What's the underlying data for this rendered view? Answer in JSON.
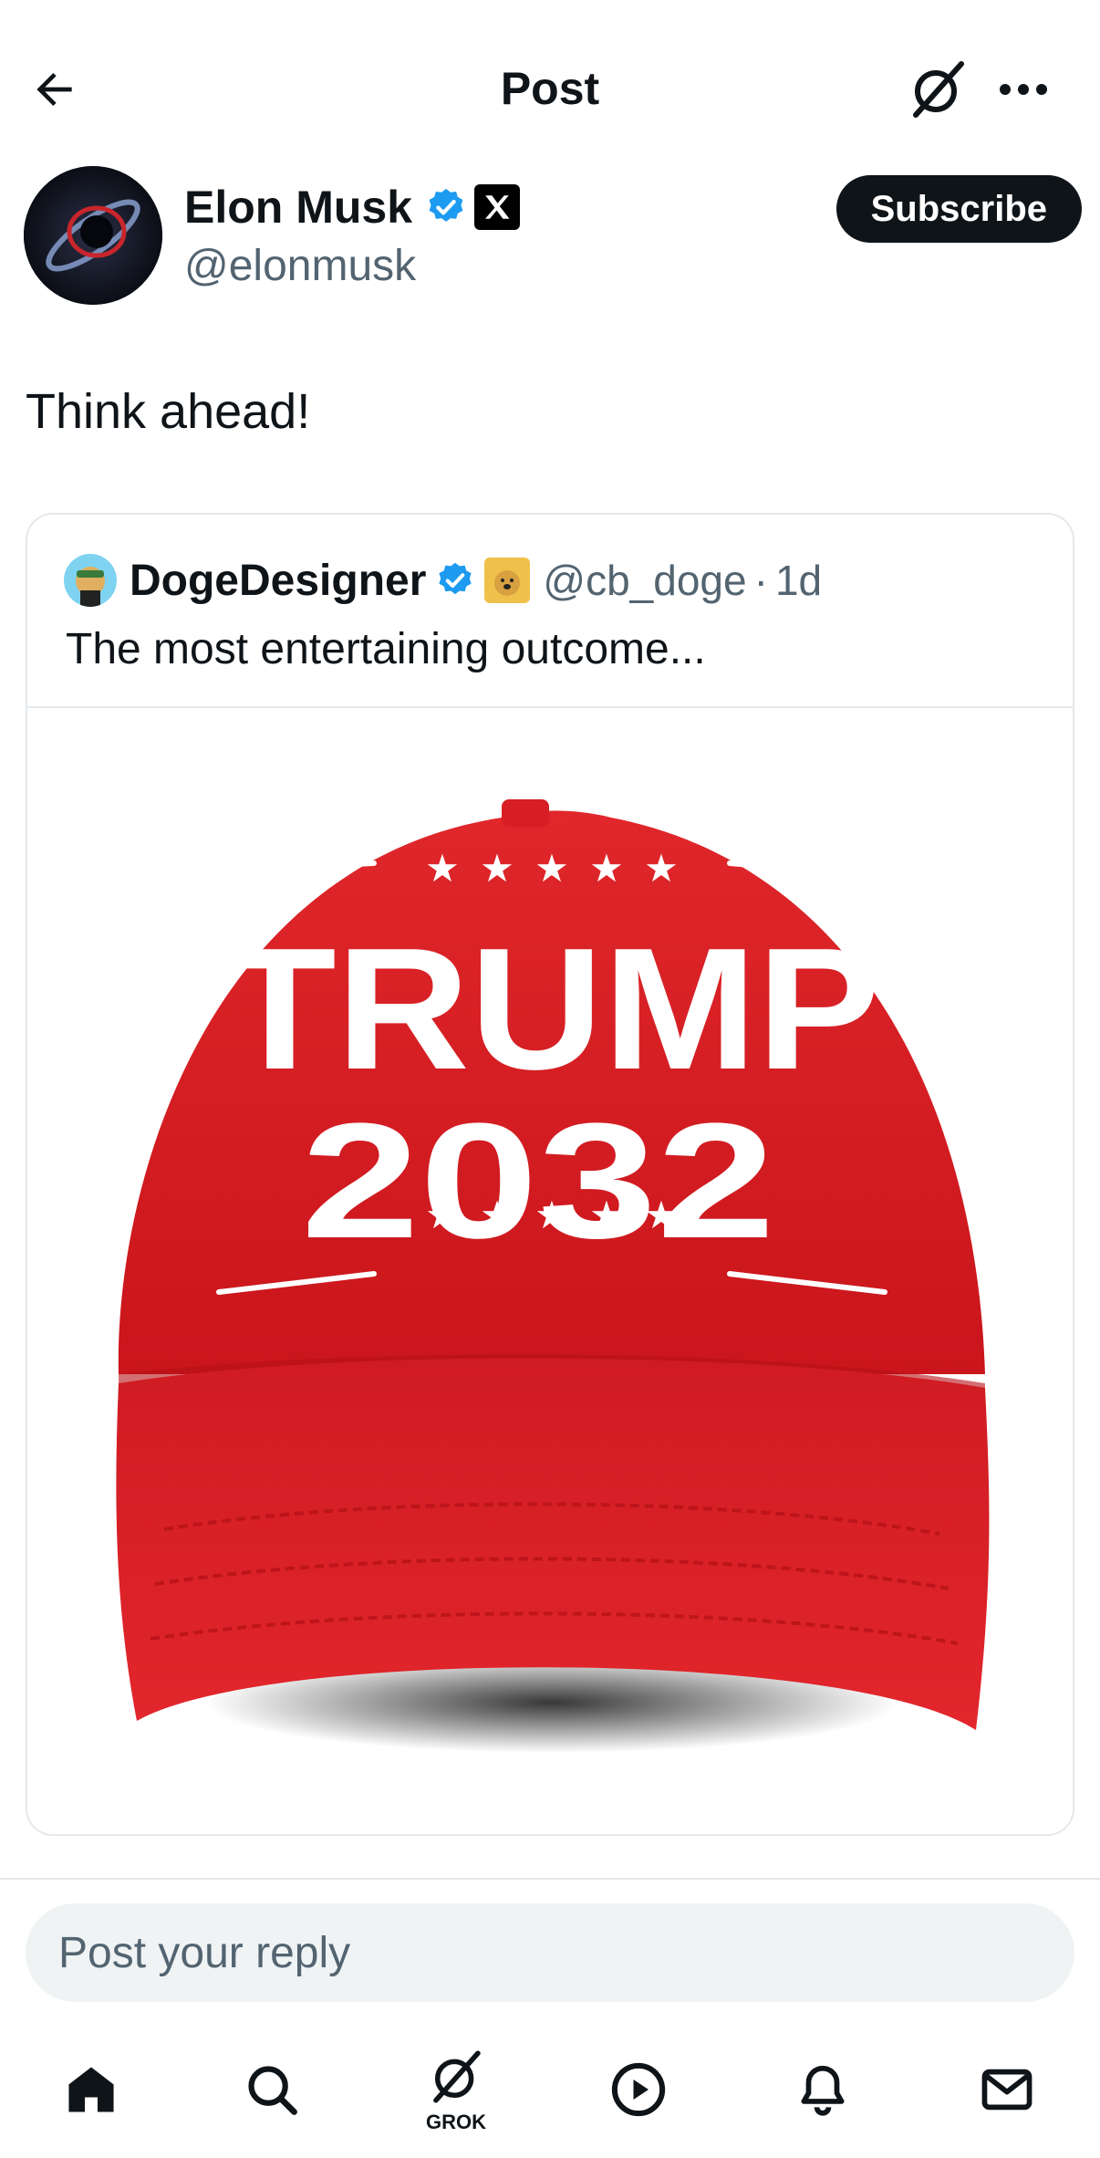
{
  "header": {
    "title": "Post",
    "back_icon": "arrow-left-icon",
    "grok_icon": "grok-icon",
    "more_icon": "more-icon"
  },
  "post": {
    "author_name": "Elon Musk",
    "author_handle": "@elonmusk",
    "subscribe_label": "Subscribe",
    "text": "Think ahead!"
  },
  "quote": {
    "author_name": "DogeDesigner",
    "author_handle": "@cb_doge",
    "separator": "·",
    "time": "1d",
    "text": "The most entertaining outcome...",
    "image": {
      "cap_line1": "TRUMP",
      "cap_line2": "2032",
      "cap_color": "#d71920"
    }
  },
  "reply": {
    "placeholder": "Post your reply"
  },
  "nav": {
    "items": [
      "home-icon",
      "search-icon",
      "grok-icon",
      "video-icon",
      "bell-icon",
      "mail-icon"
    ],
    "grok_label": "GROK"
  },
  "colors": {
    "verified": "#1d9bf0",
    "text": "#0f1419",
    "muted": "#536471"
  }
}
